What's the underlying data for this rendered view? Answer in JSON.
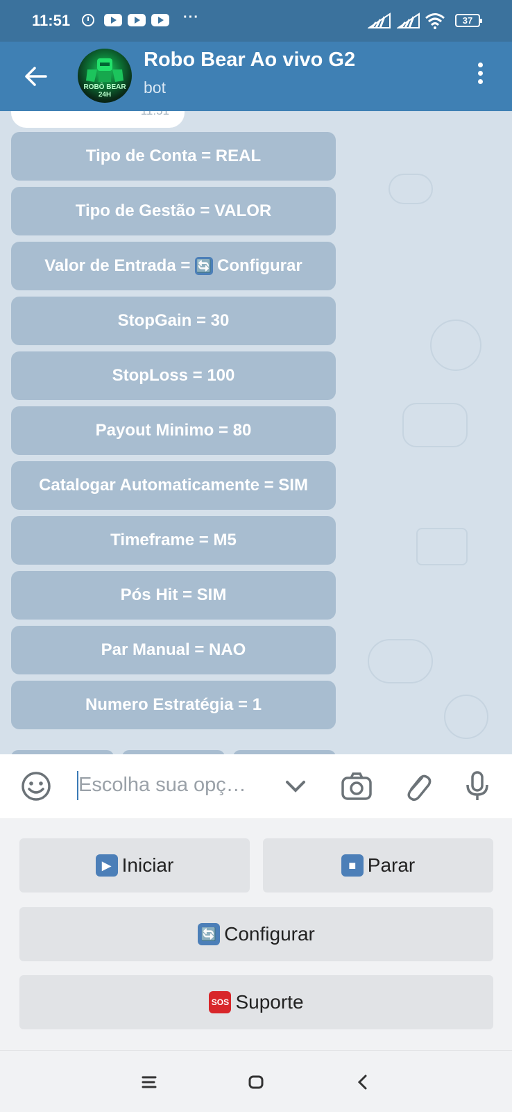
{
  "status_bar": {
    "time": "11:51",
    "battery": "37",
    "more": "···"
  },
  "header": {
    "title": "Robo Bear Ao vivo G2",
    "subtitle": "bot",
    "avatar_text": "ROBÔ BEAR 24H"
  },
  "chat": {
    "last_message_time": "11:51",
    "inline_buttons": [
      {
        "label": "Tipo de Conta = REAL",
        "emoji": ""
      },
      {
        "label": "Tipo de Gestão = VALOR",
        "emoji": ""
      },
      {
        "label": "Configurar",
        "prefix": "Valor de Entrada = ",
        "emoji": "🔄"
      },
      {
        "label": "StopGain = 30",
        "emoji": ""
      },
      {
        "label": "StopLoss = 100",
        "emoji": ""
      },
      {
        "label": "Payout Minimo = 80",
        "emoji": ""
      },
      {
        "label": "Catalogar Automaticamente = SIM",
        "emoji": ""
      },
      {
        "label": "Timeframe = M5",
        "emoji": ""
      },
      {
        "label": "Pós Hit = SIM",
        "emoji": ""
      },
      {
        "label": "Par Manual = NAO",
        "emoji": ""
      },
      {
        "label": "Numero Estratégia = 1",
        "emoji": ""
      }
    ]
  },
  "input": {
    "placeholder": "Escolha sua opç…"
  },
  "keyboard": {
    "iniciar": {
      "label": "Iniciar",
      "emoji": "▶"
    },
    "parar": {
      "label": "Parar",
      "emoji": "■"
    },
    "configurar": {
      "label": "Configurar",
      "emoji": "🔄"
    },
    "suporte": {
      "label": "Suporte",
      "emoji": "SOS"
    }
  },
  "colors": {
    "status_bar": "#3b729d",
    "header": "#3f80b4",
    "chat_bg": "#d5e0ea",
    "keyboard_bg": "#f1f2f4",
    "accent": "#3a7ab5"
  }
}
